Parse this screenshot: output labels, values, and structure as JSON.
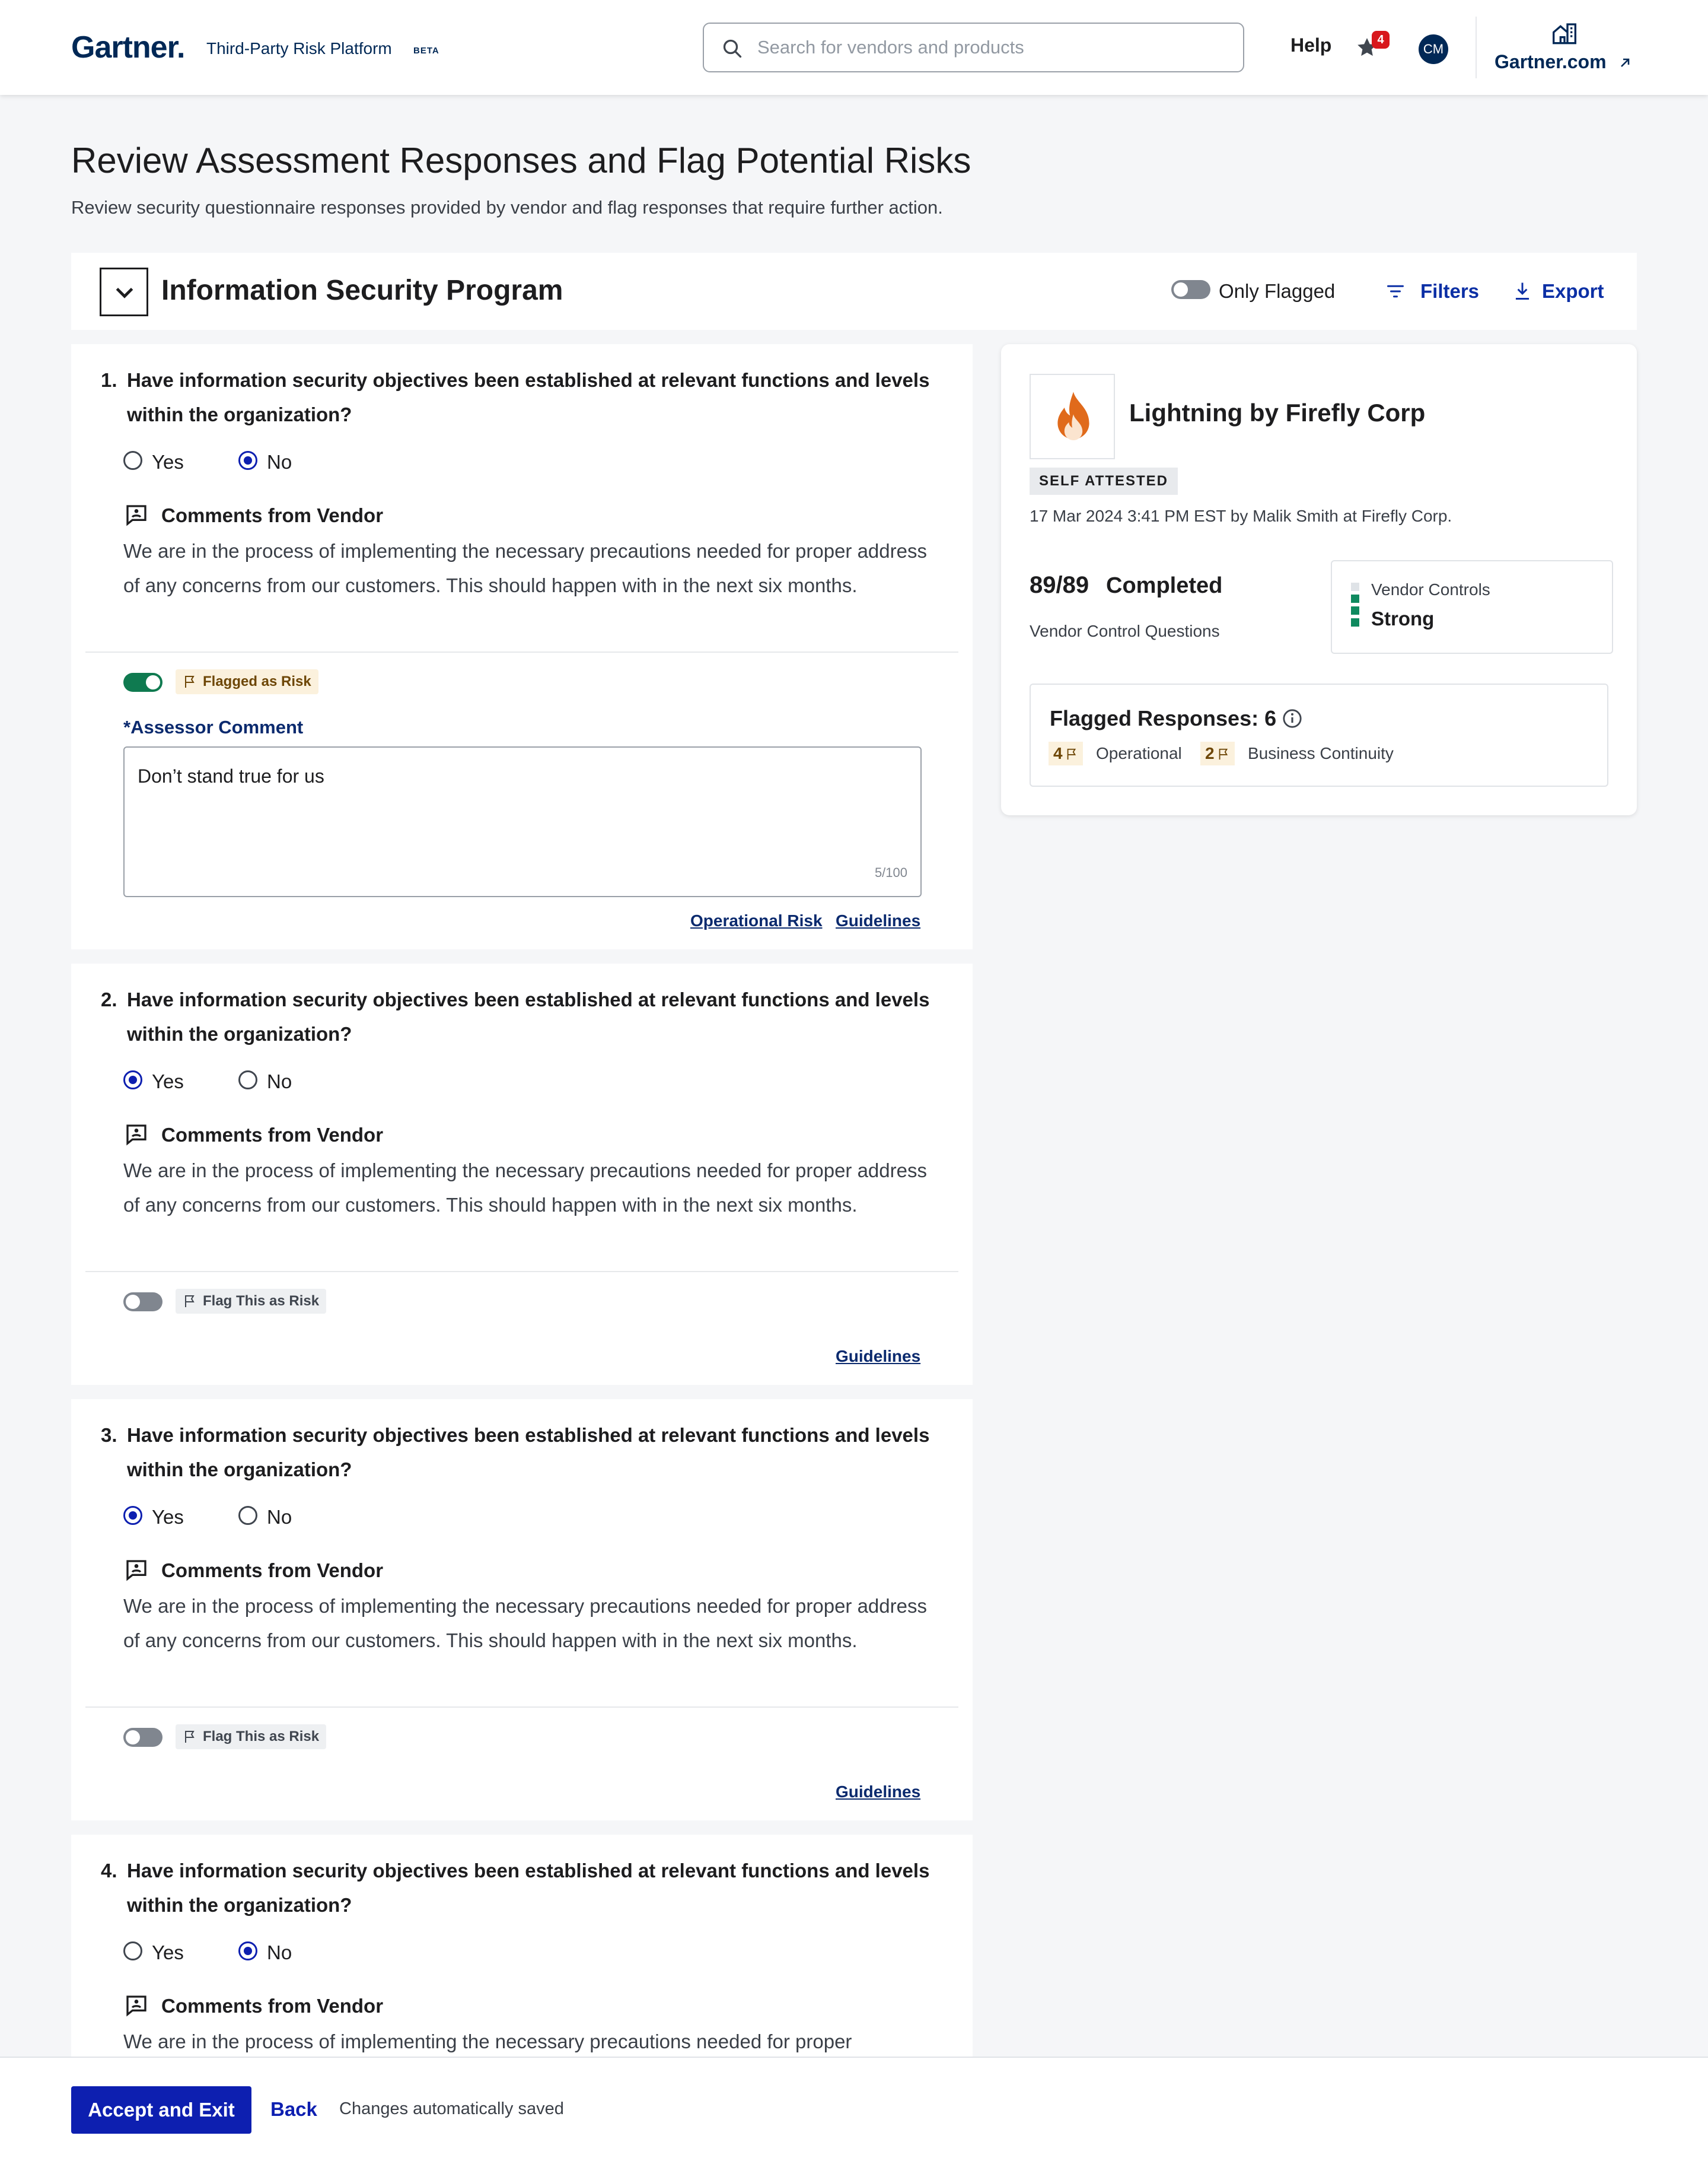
{
  "header": {
    "logo": "Gartner.",
    "platform": "Third-Party Risk Platform",
    "beta": "BETA",
    "search_placeholder": "Search for vendors and products",
    "help": "Help",
    "notification_count": "4",
    "avatar_initials": "CM",
    "gartner_link": "Gartner.com"
  },
  "page": {
    "title": "Review Assessment Responses and Flag Potential Risks",
    "subtitle": "Review security questionnaire responses provided by vendor and flag responses that require further action."
  },
  "section": {
    "title": "Information Security Program",
    "only_flagged": "Only Flagged",
    "filters": "Filters",
    "export": "Export"
  },
  "questions": [
    {
      "number": "1.",
      "text": "Have information security objectives been established at relevant functions and levels within the organization?",
      "yes_label": "Yes",
      "no_label": "No",
      "answer": "No",
      "comments_title": "Comments from Vendor",
      "comment": "We are in the process of implementing the necessary precautions needed for proper address of any concerns from our customers. This should happen with in the next six months.",
      "flag_label": "Flagged as Risk",
      "flagged": true,
      "assessor_label": "*Assessor Comment",
      "assessor_comment": "Don’t stand true for us",
      "char_count": "5/100",
      "risk_link": "Operational Risk",
      "guidelines": "Guidelines"
    },
    {
      "number": "2.",
      "text": "Have information security objectives been established at relevant functions and levels within the organization?",
      "yes_label": "Yes",
      "no_label": "No",
      "answer": "Yes",
      "comments_title": "Comments from Vendor",
      "comment": "We are in the process of implementing the necessary precautions needed for proper address of any concerns from our customers. This should happen with in the next six months.",
      "flag_label": "Flag This as Risk",
      "flagged": false,
      "guidelines": "Guidelines"
    },
    {
      "number": "3.",
      "text": "Have information security objectives been established at relevant functions and levels within the organization?",
      "yes_label": "Yes",
      "no_label": "No",
      "answer": "Yes",
      "comments_title": "Comments from Vendor",
      "comment": "We are in the process of implementing the necessary precautions needed for proper address of any concerns from our customers. This should happen with in the next six months.",
      "flag_label": "Flag This as Risk",
      "flagged": false,
      "guidelines": "Guidelines"
    },
    {
      "number": "4.",
      "text": "Have information security objectives been established at relevant functions and levels within the organization?",
      "yes_label": "Yes",
      "no_label": "No",
      "answer": "No",
      "comments_title": "Comments from Vendor",
      "comment": "We are in the process of implementing the necessary precautions needed for proper"
    }
  ],
  "vendor": {
    "name": "Lightning by Firefly Corp",
    "badge": "SELF ATTESTED",
    "attested_meta": "17 Mar 2024 3:41 PM EST by Malik Smith at Firefly Corp.",
    "completed_count": "89/89",
    "completed_label": "Completed",
    "completed_sub": "Vendor Control Questions",
    "controls_title": "Vendor Controls",
    "controls_value": "Strong",
    "flagged_title": "Flagged Responses: 6",
    "flag_counts": [
      {
        "count": "4",
        "category": "Operational"
      },
      {
        "count": "2",
        "category": "Business Continuity"
      }
    ]
  },
  "footer": {
    "accept": "Accept and Exit",
    "back": "Back",
    "saved": "Changes automatically saved"
  },
  "colors": {
    "brand_navy": "#002856",
    "primary_blue": "#0d1fb0",
    "flag_green": "#0f7a50",
    "flag_chip": "#fbf1dd",
    "badge_red": "#d8171c"
  }
}
